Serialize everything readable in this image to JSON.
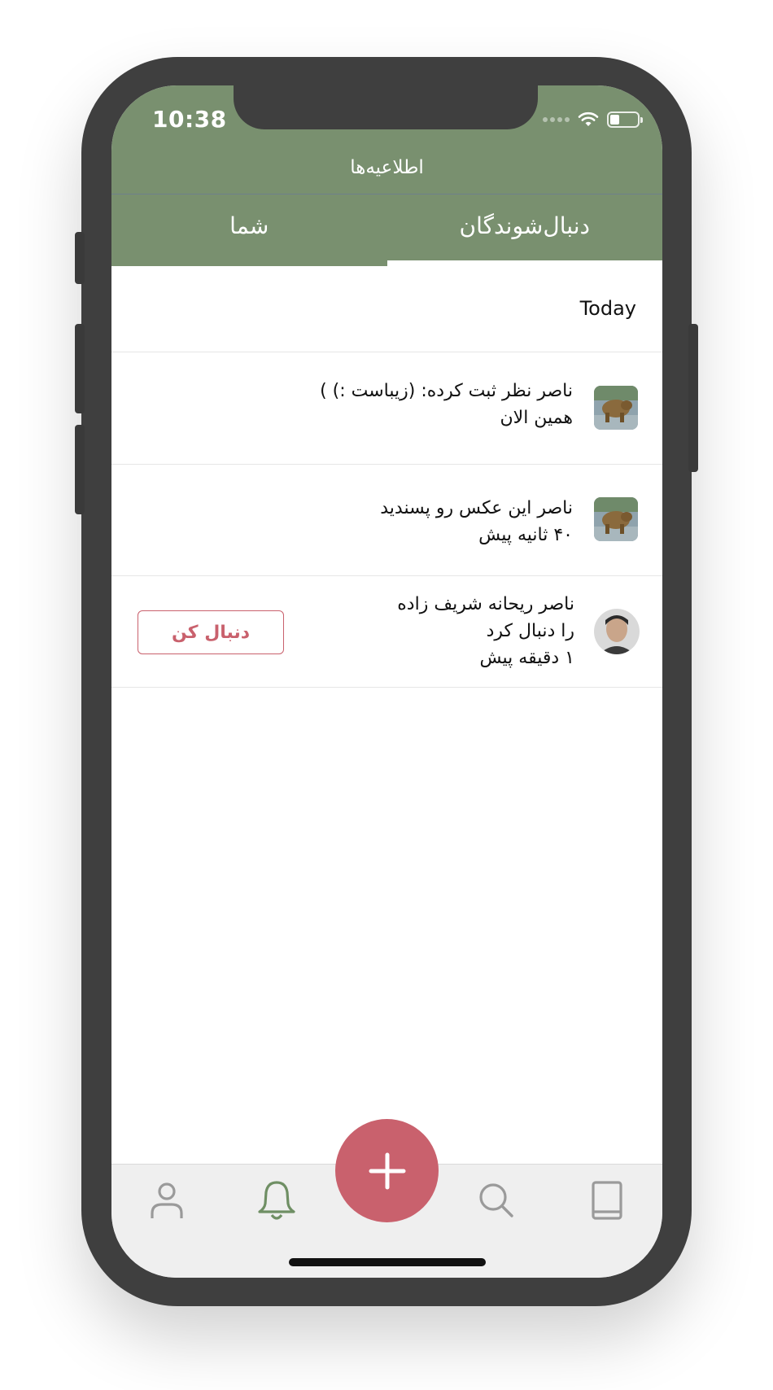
{
  "status_bar": {
    "time": "10:38"
  },
  "header": {
    "title": "اطلاعیه‌ها"
  },
  "tabs": [
    {
      "label": "دنبال‌شوندگان",
      "active": true
    },
    {
      "label": "شما",
      "active": false
    }
  ],
  "section": {
    "label": "Today"
  },
  "notifications": [
    {
      "line1": "ناصر نظر ثبت کرده: (زیباست :) )",
      "line2": "همین الان",
      "thumb": "bear-photo"
    },
    {
      "line1": "ناصر این عکس رو پسندید",
      "line2": "۴۰ ثانیه پیش",
      "thumb": "bear-photo"
    },
    {
      "line1": "ناصر ریحانه شریف زاده",
      "line2": "را دنبال کرد",
      "line3": "۱ دقیقه پیش",
      "thumb": "user-avatar",
      "action_label": "دنبال کن"
    }
  ],
  "tabbar": {
    "items": [
      "profile-icon",
      "bell-icon",
      "add-icon",
      "search-icon",
      "book-icon"
    ],
    "active": "bell-icon"
  },
  "colors": {
    "primary": "#79906f",
    "accent": "#c9616d"
  }
}
